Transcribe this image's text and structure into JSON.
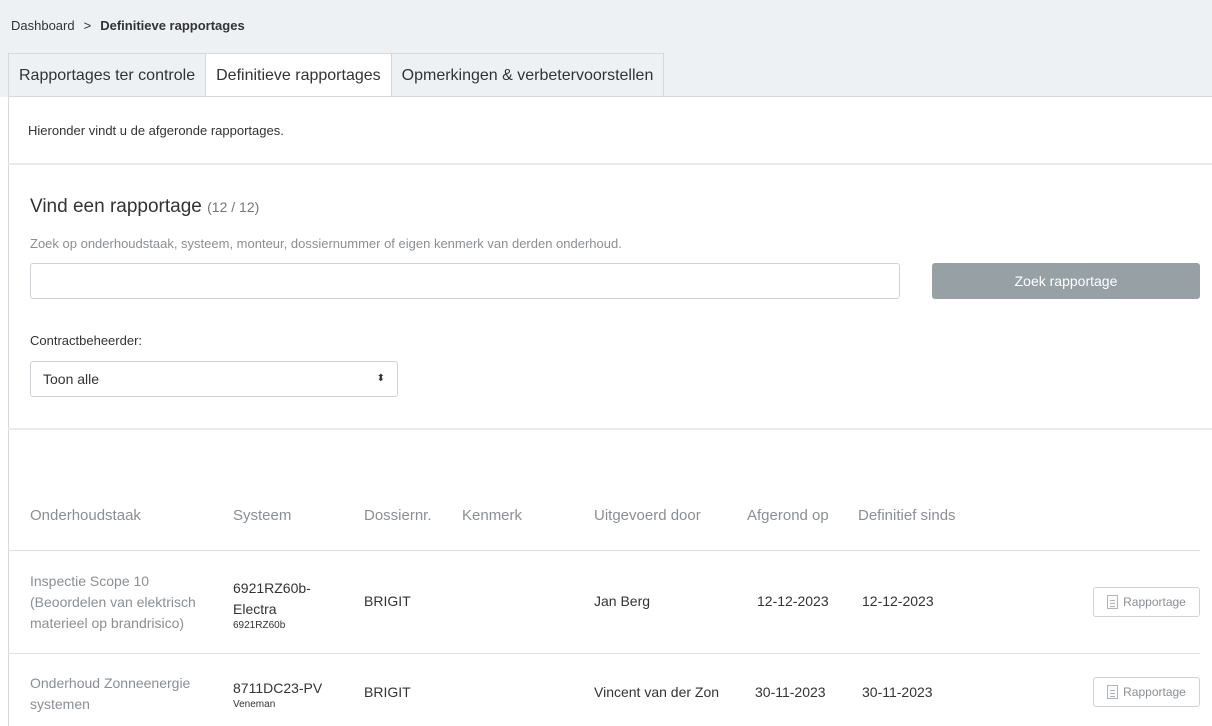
{
  "breadcrumb": {
    "root": "Dashboard",
    "separator": ">",
    "current": "Definitieve rapportages"
  },
  "tabs": [
    {
      "label": "Rapportages ter controle",
      "active": false
    },
    {
      "label": "Definitieve rapportages",
      "active": true
    },
    {
      "label": "Opmerkingen & verbetervoorstellen",
      "active": false
    }
  ],
  "intro": "Hieronder vindt u de afgeronde rapportages.",
  "search": {
    "title": "Vind een rapportage",
    "count": "(12 / 12)",
    "hint": "Zoek op onderhoudstaak, systeem, monteur, dossiernummer of eigen kenmerk van derden onderhoud.",
    "value": "",
    "button": "Zoek rapportage"
  },
  "filter": {
    "label": "Contractbeheerder:",
    "selected": "Toon alle"
  },
  "table": {
    "headers": [
      "Onderhoudstaak",
      "Systeem",
      "Dossiernr.",
      "Kenmerk",
      "Uitgevoerd door",
      "Afgerond op",
      "Definitief sinds"
    ],
    "rows": [
      {
        "task": [
          "Inspectie Scope 10",
          "(Beoordelen van elektrisch",
          "materieel op brandrisico)"
        ],
        "system": [
          "6921RZ60b-",
          "Electra"
        ],
        "system_sub": "6921RZ60b",
        "dossier": "BRIGIT",
        "kenmerk": "",
        "by": "Jan Berg",
        "completed": "12-12-2023",
        "final": "12-12-2023",
        "action": "Rapportage"
      },
      {
        "task": [
          "Onderhoud Zonneenergie",
          "systemen"
        ],
        "system": [
          "8711DC23-PV"
        ],
        "system_sub": "Veneman",
        "dossier": "BRIGIT",
        "kenmerk": "",
        "by": "Vincent van der Zon",
        "completed": "30-11-2023",
        "final": "30-11-2023",
        "action": "Rapportage"
      }
    ]
  }
}
